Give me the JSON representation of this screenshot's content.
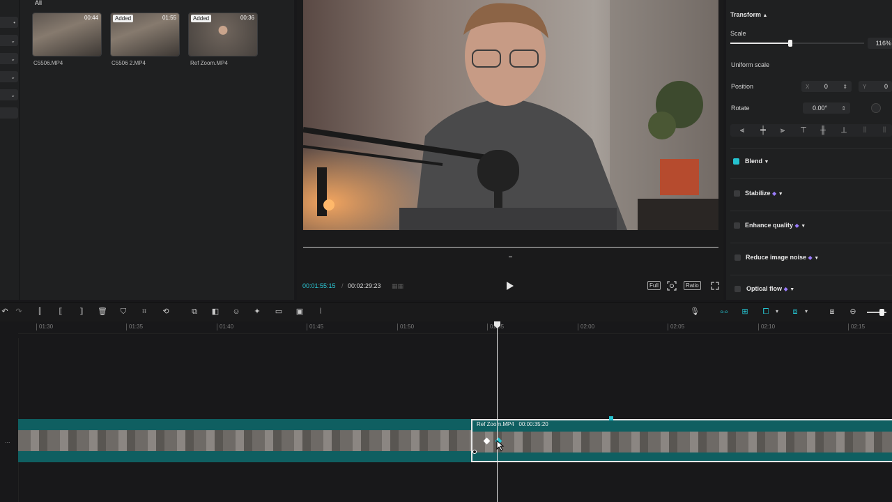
{
  "media": {
    "filter_label": "All",
    "clips": [
      {
        "name": "C5506.MP4",
        "duration": "00:44",
        "added": ""
      },
      {
        "name": "C5506 2.MP4",
        "duration": "01:55",
        "added": "Added"
      },
      {
        "name": "Ref Zoom.MP4",
        "duration": "00:36",
        "added": "Added"
      }
    ]
  },
  "player": {
    "current_time": "00:01:55:15",
    "separator": "/",
    "total_time": "00:02:29:23",
    "full_label": "Full",
    "ratio_label": "Ratio"
  },
  "inspector": {
    "transform_label": "Transform",
    "scale_label": "Scale",
    "scale_value": "116%",
    "scale_fraction": 0.45,
    "uniform_scale_label": "Uniform scale",
    "position_label": "Position",
    "x_label": "X",
    "x_value": "0",
    "y_label": "Y",
    "y_value": "0",
    "rotate_label": "Rotate",
    "rotate_value": "0.00°",
    "blend_label": "Blend",
    "stabilize_label": "Stabilize",
    "enhance_label": "Enhance quality",
    "noise_label": "Reduce image noise",
    "flow_label": "Optical flow"
  },
  "timeline": {
    "ticks": [
      "01:30",
      "01:35",
      "01:40",
      "01:45",
      "01:50",
      "01:55",
      "02:00",
      "02:05",
      "02:10",
      "02:15"
    ],
    "clip_name": "Ref Zoom.MP4",
    "clip_duration": "00:00:35:20",
    "track_menu": "..."
  },
  "colors": {
    "accent": "#25c2cf",
    "track": "#0f5f61"
  }
}
